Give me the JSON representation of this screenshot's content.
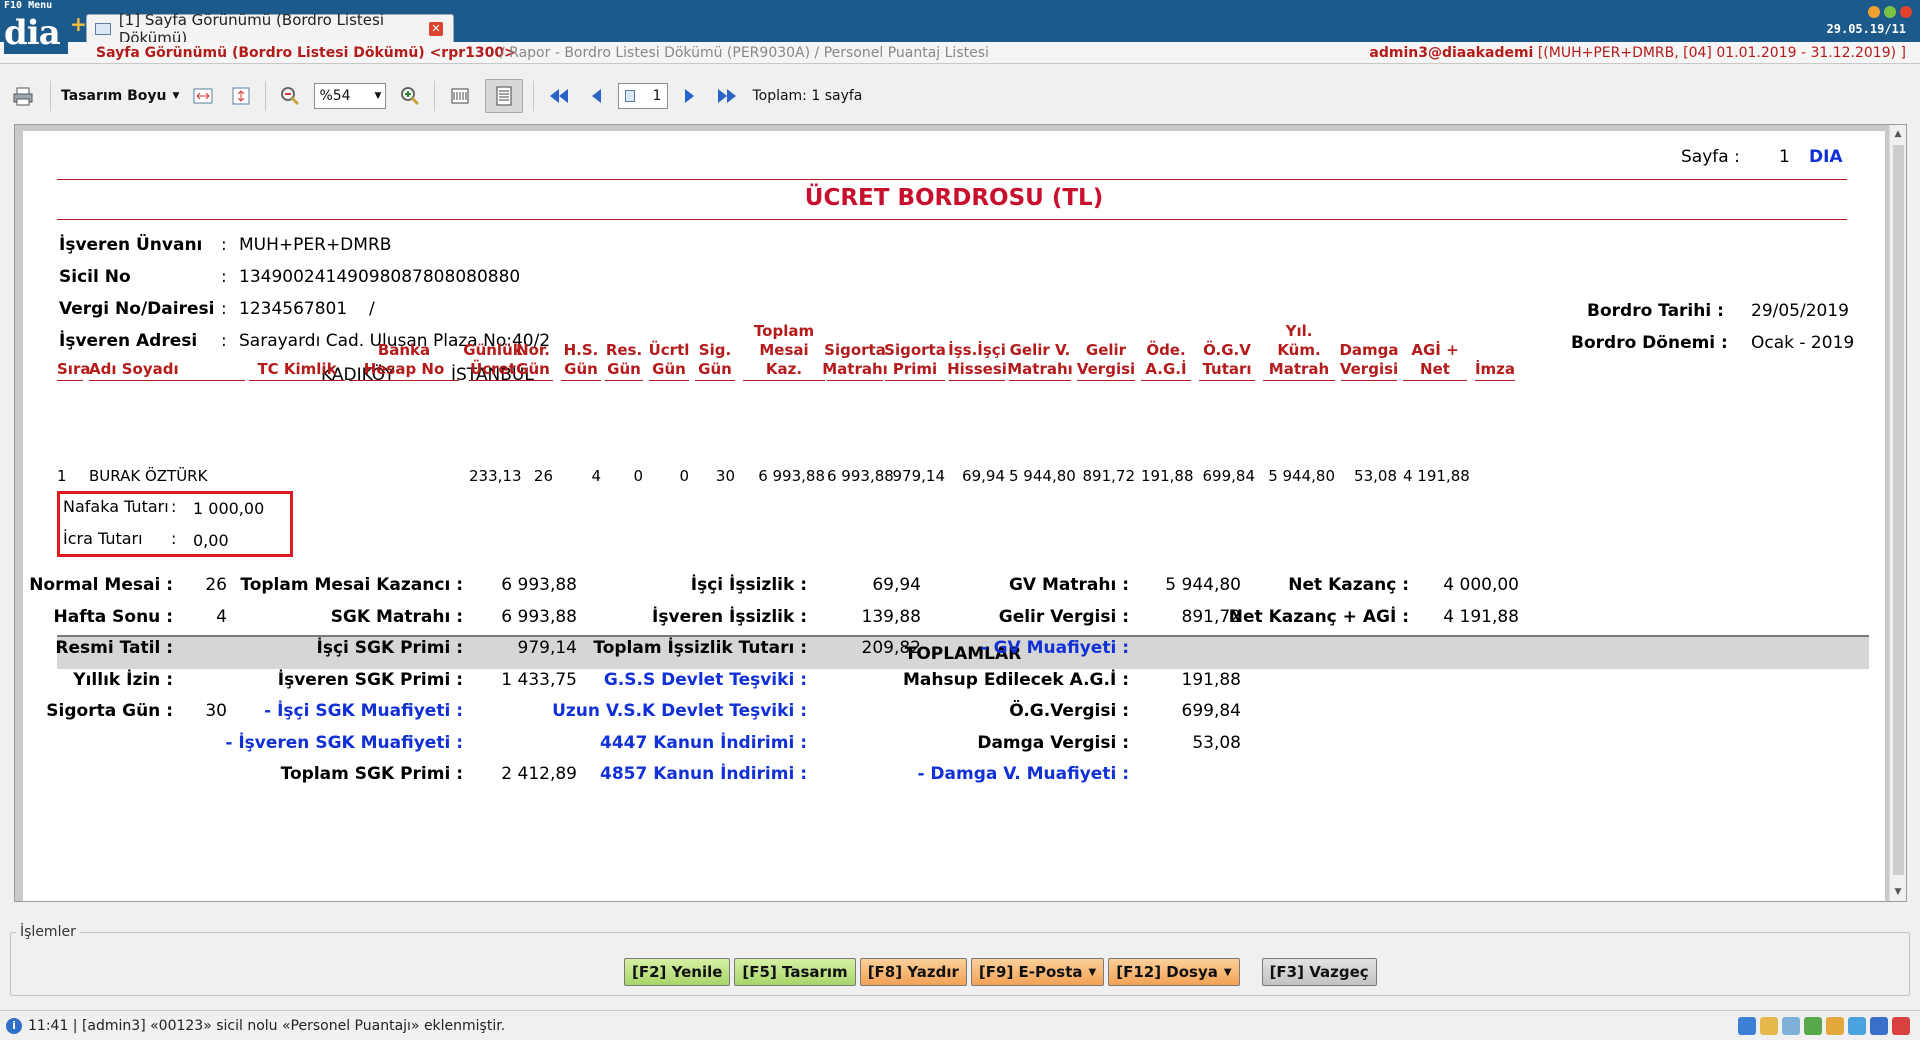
{
  "titlebar": {
    "f10": "F10 Menu",
    "logo": "dia",
    "tab_title": "[1] Sayfa Görünümü (Bordro Listesi Dökümü)",
    "date": "29.05.19/11"
  },
  "breadcrumb": {
    "main": "Sayfa Görünümü (Bordro Listesi Dökümü) <rpr1300>",
    "rest": "/ Rapor - Bordro Listesi Dökümü (PER9030A) / Personel Puantaj Listesi",
    "user": "admin3@diaakademi",
    "context": "[(MUH+PER+DMRB, [04] 01.01.2019 - 31.12.2019) ]"
  },
  "toolbar": {
    "design_size": "Tasarım Boyu",
    "zoom": "%54",
    "page": "1",
    "total": "Toplam: 1 sayfa"
  },
  "report": {
    "page_label": "Sayfa :",
    "page_no": "1",
    "brand": "DIA",
    "title": "ÜCRET BORDROSU (TL)",
    "employer_label": "İşveren Ünvanı",
    "employer": "MUH+PER+DMRB",
    "sicil_label": "Sicil No",
    "sicil": "1349002414909808780808088​0",
    "vergi_label": "Vergi No/Dairesi",
    "vergi": "1234567801",
    "vergi_slash": "/",
    "address_label": "İşveren Adresi",
    "address1": "Sarayardı Cad. Ulusan Plaza No:40/2",
    "district": "KADIKÖY",
    "city": "İSTANBUL",
    "colon": ":",
    "bordro_tarihi_label": "Bordro Tarihi :",
    "bordro_tarihi": "29/05/2019",
    "bordro_donemi_label": "Bordro Dönemi :",
    "bordro_donemi": "Ocak - 2019",
    "columns": [
      "Sıra",
      "Adı Soyadı",
      "TC Kimlik",
      "Banka Hesap No",
      "Günlük Ücret",
      "Nor. Gün",
      "H.S. Gün",
      "Res. Gün",
      "Ücrtl Gün",
      "Sig. Gün",
      "Toplam Mesai Kaz.",
      "Sigorta Matrahı",
      "Sigorta Primi",
      "İşs.İşçi Hissesi",
      "Gelir V. Matrahı",
      "Gelir Vergisi",
      "Öde. A.G.İ",
      "Ö.G.V Tutarı",
      "Yıl. Küm. Matrah",
      "Damga Vergisi",
      "AGİ + Net",
      "İmza"
    ],
    "row": {
      "sira": "1",
      "name": "BURAK ÖZTÜRK",
      "gunluk": "233,13",
      "nor": "26",
      "hs": "4",
      "res": "0",
      "ucrtl": "0",
      "sig": "30",
      "toplam_mesai": "6 993,88",
      "sig_matrah": "6 993,88",
      "sig_primi": "979,14",
      "iss_isci": "69,94",
      "gv_matrah": "5 944,80",
      "gelir_vergisi": "891,72",
      "ode_agi": "191,88",
      "ogv": "699,84",
      "yil_kum": "5 944,80",
      "damga": "53,08",
      "agi_net": "4 191,88"
    },
    "nafaka_label": "Nafaka Tutarı",
    "nafaka": "1 000,00",
    "icra_label": "İcra Tutarı",
    "icra": "0,00",
    "totals_title": "TOPLAMLAR",
    "totals": {
      "col1": [
        {
          "label": "Normal Mesai :",
          "value": "26"
        },
        {
          "label": "Hafta Sonu :",
          "value": "4"
        },
        {
          "label": "Resmi Tatil :",
          "value": ""
        },
        {
          "label": "Yıllık İzin :",
          "value": ""
        },
        {
          "label": "Sigorta Gün :",
          "value": "30"
        }
      ],
      "col2": [
        {
          "label": "Toplam Mesai Kazancı :",
          "value": "6 993,88"
        },
        {
          "label": "SGK Matrahı :",
          "value": "6 993,88"
        },
        {
          "label": "İşçi SGK Primi :",
          "value": "979,14"
        },
        {
          "label": "İşveren SGK Primi :",
          "value": "1 433,75"
        },
        {
          "label": "- İşçi SGK Muafiyeti :",
          "value": ""
        },
        {
          "label": "- İşveren SGK Muafiyeti :",
          "value": ""
        },
        {
          "label": "Toplam  SGK Primi :",
          "value": "2 412,89"
        }
      ],
      "col3": [
        {
          "label": "İşçi İşsizlik :",
          "value": "69,94"
        },
        {
          "label": "İşveren İşsizlik :",
          "value": "139,88"
        },
        {
          "label": "Toplam  İşsizlik Tutarı :",
          "value": "209,82"
        },
        {
          "label": "G.S.S Devlet Teşviki :",
          "value": ""
        },
        {
          "label": "Uzun V.S.K Devlet Teşviki :",
          "value": ""
        },
        {
          "label": "4447 Kanun İndirimi :",
          "value": ""
        },
        {
          "label": "4857 Kanun İndirimi :",
          "value": ""
        }
      ],
      "col4": [
        {
          "label": "GV Matrahı :",
          "value": "5 944,80"
        },
        {
          "label": "Gelir Vergisi :",
          "value": "891,72"
        },
        {
          "label": "- GV Muafiyeti :",
          "value": ""
        },
        {
          "label": "Mahsup Edilecek A.G.İ :",
          "value": "191,88"
        },
        {
          "label": "Ö.G.Vergisi :",
          "value": "699,84"
        },
        {
          "label": "Damga Vergisi :",
          "value": "53,08"
        },
        {
          "label": "- Damga V. Muafiyeti :",
          "value": ""
        }
      ],
      "col5": [
        {
          "label": "Net Kazanç :",
          "value": "4 000,00"
        },
        {
          "label": "Net Kazanç + AGİ :",
          "value": "4 191,88"
        }
      ]
    }
  },
  "actions": {
    "group_label": "İşlemler",
    "refresh": "[F2] Yenile",
    "design": "[F5] Tasarım",
    "print": "[F8] Yazdır",
    "email": "[F9] E-Posta",
    "file": "[F12] Dosya",
    "cancel": "[F3] Vazgeç"
  },
  "status": {
    "message": "11:41 | [admin3] «00123» sicil nolu «Personel Puantajı» eklenmiştir."
  },
  "colors": {
    "titlebar": "#1d5a8c",
    "accent_red": "#b41c1c",
    "blue_text": "#1130d6",
    "highlight_box": "#e01b22"
  }
}
